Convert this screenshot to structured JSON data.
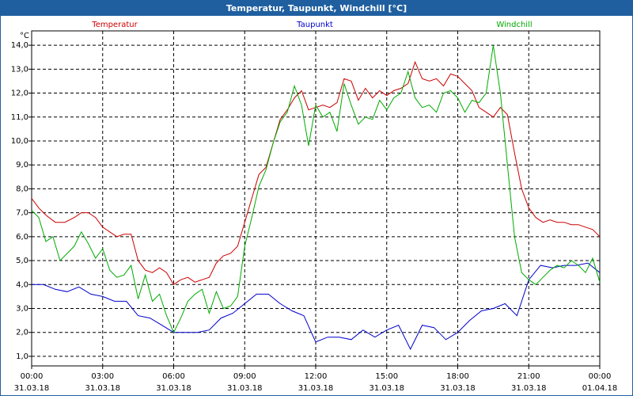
{
  "window": {
    "title": "Temperatur, Taupunkt, Windchill [°C]"
  },
  "chart_data": {
    "type": "line",
    "ylabel": "°C",
    "ylim": [
      0.6,
      14.6
    ],
    "xlim_hours": [
      0,
      24
    ],
    "grid": true,
    "yticks": [
      "1,0",
      "2,0",
      "3,0",
      "4,0",
      "5,0",
      "6,0",
      "7,0",
      "8,0",
      "9,0",
      "10,0",
      "11,0",
      "12,0",
      "13,0",
      "14,0"
    ],
    "xticks": [
      {
        "time": "00:00",
        "date": "31.03.18"
      },
      {
        "time": "03:00",
        "date": "31.03.18"
      },
      {
        "time": "06:00",
        "date": "31.03.18"
      },
      {
        "time": "09:00",
        "date": "31.03.18"
      },
      {
        "time": "12:00",
        "date": "31.03.18"
      },
      {
        "time": "15:00",
        "date": "31.03.18"
      },
      {
        "time": "18:00",
        "date": "31.03.18"
      },
      {
        "time": "21:00",
        "date": "31.03.18"
      },
      {
        "time": "00:00",
        "date": "01.04.18"
      }
    ],
    "series": [
      {
        "name": "Temperatur",
        "color": "#cc0000",
        "x": [
          0,
          0.3,
          0.6,
          1,
          1.4,
          1.8,
          2.1,
          2.4,
          2.7,
          3.0,
          3.3,
          3.6,
          3.9,
          4.2,
          4.5,
          4.8,
          5.1,
          5.4,
          5.7,
          6.0,
          6.3,
          6.6,
          6.9,
          7.2,
          7.5,
          7.8,
          8.1,
          8.4,
          8.7,
          9.0,
          9.3,
          9.6,
          9.9,
          10.2,
          10.5,
          10.8,
          11.1,
          11.4,
          11.7,
          12.0,
          12.3,
          12.6,
          12.9,
          13.2,
          13.5,
          13.8,
          14.1,
          14.4,
          14.7,
          15.0,
          15.3,
          15.6,
          15.9,
          16.2,
          16.5,
          16.8,
          17.1,
          17.4,
          17.7,
          18.0,
          18.3,
          18.6,
          18.9,
          19.2,
          19.5,
          19.8,
          20.1,
          20.4,
          20.7,
          21.0,
          21.3,
          21.6,
          21.9,
          22.2,
          22.5,
          22.8,
          23.1,
          23.4,
          23.7,
          24.0
        ],
        "values": [
          7.6,
          7.2,
          6.9,
          6.6,
          6.6,
          6.8,
          7.0,
          7.0,
          6.8,
          6.4,
          6.2,
          6.0,
          6.1,
          6.1,
          5.0,
          4.6,
          4.5,
          4.7,
          4.5,
          4.0,
          4.2,
          4.3,
          4.1,
          4.2,
          4.3,
          4.9,
          5.2,
          5.3,
          5.6,
          6.6,
          7.6,
          8.6,
          8.9,
          9.9,
          10.9,
          11.3,
          11.8,
          12.1,
          11.3,
          11.4,
          11.5,
          11.4,
          11.6,
          12.6,
          12.5,
          11.7,
          12.2,
          11.8,
          12.1,
          11.9,
          12.1,
          12.2,
          12.4,
          13.3,
          12.6,
          12.5,
          12.6,
          12.3,
          12.8,
          12.7,
          12.4,
          12.1,
          11.4,
          11.2,
          11.0,
          11.4,
          11.1,
          9.5,
          8.0,
          7.2,
          6.8,
          6.6,
          6.7,
          6.6,
          6.6,
          6.5,
          6.5,
          6.4,
          6.3,
          6.0
        ]
      },
      {
        "name": "Taupunkt",
        "color": "#0000cc",
        "x": [
          0,
          0.5,
          1,
          1.5,
          2,
          2.5,
          3,
          3.5,
          4,
          4.5,
          5,
          5.5,
          6,
          6.5,
          7,
          7.5,
          8,
          8.5,
          9,
          9.5,
          10,
          10.5,
          11,
          11.5,
          12,
          12.5,
          13,
          13.5,
          14,
          14.5,
          15,
          15.5,
          16,
          16.5,
          17,
          17.5,
          18,
          18.5,
          19,
          19.5,
          20,
          20.5,
          21,
          21.5,
          22,
          22.5,
          23,
          23.5,
          24
        ],
        "values": [
          4.0,
          4.0,
          3.8,
          3.7,
          3.9,
          3.6,
          3.5,
          3.3,
          3.3,
          2.7,
          2.6,
          2.3,
          2.0,
          2.0,
          2.0,
          2.1,
          2.6,
          2.8,
          3.2,
          3.6,
          3.6,
          3.2,
          2.9,
          2.7,
          1.6,
          1.8,
          1.8,
          1.7,
          2.1,
          1.8,
          2.1,
          2.3,
          1.3,
          2.3,
          2.2,
          1.7,
          2.0,
          2.5,
          2.9,
          3.0,
          3.2,
          2.7,
          4.2,
          4.8,
          4.7,
          4.8,
          4.8,
          4.9,
          4.5
        ]
      },
      {
        "name": "Windchill",
        "color": "#00aa00",
        "x": [
          0,
          0.3,
          0.6,
          0.9,
          1.2,
          1.5,
          1.8,
          2.1,
          2.4,
          2.7,
          3.0,
          3.3,
          3.6,
          3.9,
          4.2,
          4.5,
          4.8,
          5.1,
          5.4,
          5.7,
          6.0,
          6.3,
          6.6,
          6.9,
          7.2,
          7.5,
          7.8,
          8.1,
          8.4,
          8.7,
          9.0,
          9.3,
          9.6,
          9.9,
          10.2,
          10.5,
          10.8,
          11.1,
          11.4,
          11.7,
          12.0,
          12.3,
          12.6,
          12.9,
          13.2,
          13.5,
          13.8,
          14.1,
          14.4,
          14.7,
          15.0,
          15.3,
          15.6,
          15.9,
          16.2,
          16.5,
          16.8,
          17.1,
          17.4,
          17.7,
          18.0,
          18.3,
          18.6,
          18.9,
          19.2,
          19.5,
          19.8,
          20.1,
          20.4,
          20.7,
          21.0,
          21.3,
          21.6,
          21.9,
          22.2,
          22.5,
          22.8,
          23.1,
          23.4,
          23.7,
          24.0
        ],
        "values": [
          7.1,
          6.8,
          5.8,
          6.0,
          5.0,
          5.3,
          5.6,
          6.2,
          5.7,
          5.1,
          5.5,
          4.6,
          4.3,
          4.4,
          4.8,
          3.4,
          4.4,
          3.3,
          3.6,
          2.7,
          2.0,
          2.6,
          3.3,
          3.6,
          3.8,
          2.8,
          3.7,
          3.0,
          3.1,
          3.5,
          5.6,
          6.8,
          8.1,
          8.8,
          9.9,
          10.8,
          11.2,
          12.3,
          11.5,
          9.8,
          11.5,
          11.0,
          11.2,
          10.4,
          12.4,
          11.5,
          10.7,
          11.0,
          10.9,
          11.7,
          11.3,
          11.8,
          12.0,
          12.9,
          11.8,
          11.4,
          11.5,
          11.2,
          12.0,
          12.1,
          11.8,
          11.2,
          11.7,
          11.6,
          12.0,
          14.0,
          12.0,
          9.0,
          6.0,
          4.5,
          4.2,
          4.0,
          4.3,
          4.6,
          4.8,
          4.7,
          5.0,
          4.8,
          4.5,
          5.1,
          4.1
        ]
      }
    ]
  }
}
